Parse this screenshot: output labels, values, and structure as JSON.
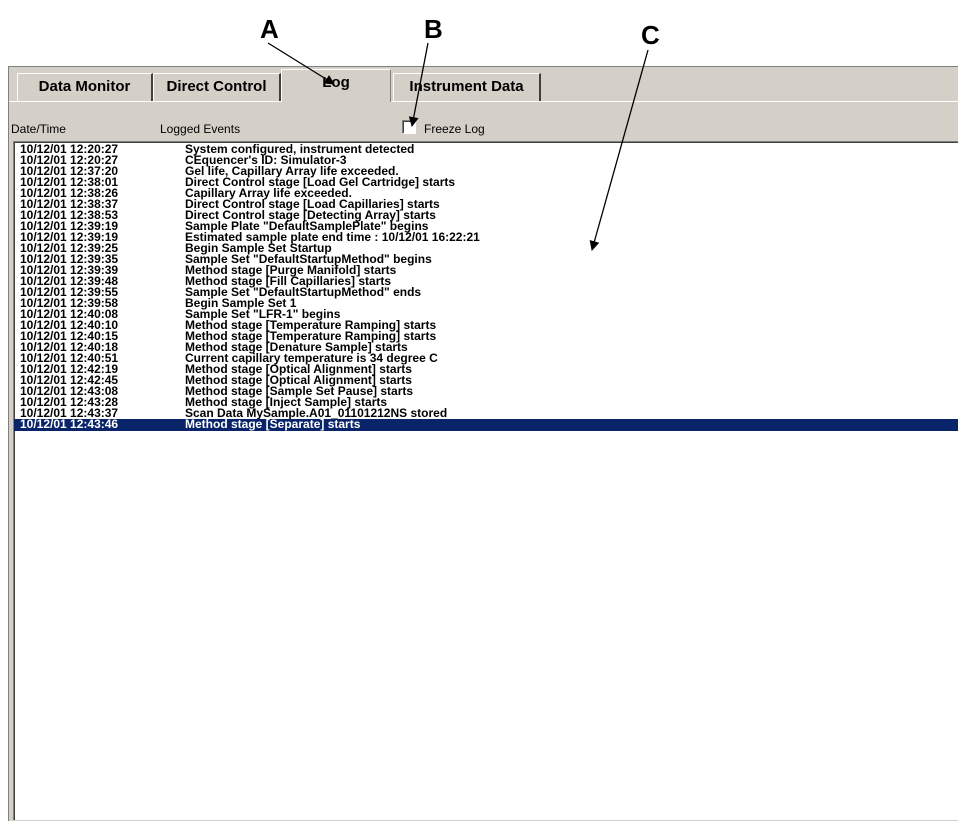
{
  "callouts": [
    "A",
    "B",
    "C"
  ],
  "tabs": [
    {
      "label": "Data Monitor"
    },
    {
      "label": "Direct Control"
    },
    {
      "label": "Log"
    },
    {
      "label": "Instrument Data"
    }
  ],
  "columns": {
    "datetime": "Date/Time",
    "events": "Logged Events"
  },
  "freeze_log": {
    "label": "Freeze Log",
    "checked": false
  },
  "log": [
    {
      "datetime": "10/12/01 12:20:27",
      "event": "System configured, instrument detected"
    },
    {
      "datetime": "10/12/01 12:20:27",
      "event": "CEquencer's ID: Simulator-3"
    },
    {
      "datetime": "10/12/01 12:37:20",
      "event": "Gel life, Capillary Array life exceeded."
    },
    {
      "datetime": "10/12/01 12:38:01",
      "event": "Direct Control stage [Load Gel Cartridge] starts"
    },
    {
      "datetime": "10/12/01 12:38:26",
      "event": "Capillary Array life exceeded."
    },
    {
      "datetime": "10/12/01 12:38:37",
      "event": "Direct Control stage [Load Capillaries] starts"
    },
    {
      "datetime": "10/12/01 12:38:53",
      "event": "Direct Control stage [Detecting Array] starts"
    },
    {
      "datetime": "10/12/01 12:39:19",
      "event": "Sample Plate \"DefaultSamplePlate\" begins"
    },
    {
      "datetime": "10/12/01 12:39:19",
      "event": "Estimated sample plate end time : 10/12/01 16:22:21"
    },
    {
      "datetime": "10/12/01 12:39:25",
      "event": "Begin Sample Set Startup"
    },
    {
      "datetime": "10/12/01 12:39:35",
      "event": "Sample Set \"DefaultStartupMethod\" begins"
    },
    {
      "datetime": "10/12/01 12:39:39",
      "event": "Method stage [Purge Manifold] starts"
    },
    {
      "datetime": "10/12/01 12:39:48",
      "event": "Method stage [Fill Capillaries] starts"
    },
    {
      "datetime": "10/12/01 12:39:55",
      "event": "Sample Set \"DefaultStartupMethod\" ends"
    },
    {
      "datetime": "10/12/01 12:39:58",
      "event": "Begin Sample Set 1"
    },
    {
      "datetime": "10/12/01 12:40:08",
      "event": "Sample Set \"LFR-1\" begins"
    },
    {
      "datetime": "10/12/01 12:40:10",
      "event": "Method stage [Temperature Ramping] starts"
    },
    {
      "datetime": "10/12/01 12:40:15",
      "event": "Method stage [Temperature Ramping] starts"
    },
    {
      "datetime": "10/12/01 12:40:18",
      "event": "Method stage [Denature Sample] starts"
    },
    {
      "datetime": "10/12/01 12:40:51",
      "event": "Current capillary temperature is 34 degree C"
    },
    {
      "datetime": "10/12/01 12:42:19",
      "event": "Method stage [Optical Alignment] starts"
    },
    {
      "datetime": "10/12/01 12:42:45",
      "event": "Method stage [Optical Alignment] starts"
    },
    {
      "datetime": "10/12/01 12:43:08",
      "event": "Method stage [Sample Set Pause] starts"
    },
    {
      "datetime": "10/12/01 12:43:28",
      "event": "Method stage [Inject Sample] starts"
    },
    {
      "datetime": "10/12/01 12:43:37",
      "event": "Scan Data MySample.A01_01101212NS stored"
    },
    {
      "datetime": "10/12/01 12:43:46",
      "event": "Method stage [Separate] starts",
      "selected": true
    }
  ],
  "colors": {
    "window_bg": "#d4d0c8",
    "selection_bg": "#0a246a",
    "selection_text": "#ffffff"
  }
}
